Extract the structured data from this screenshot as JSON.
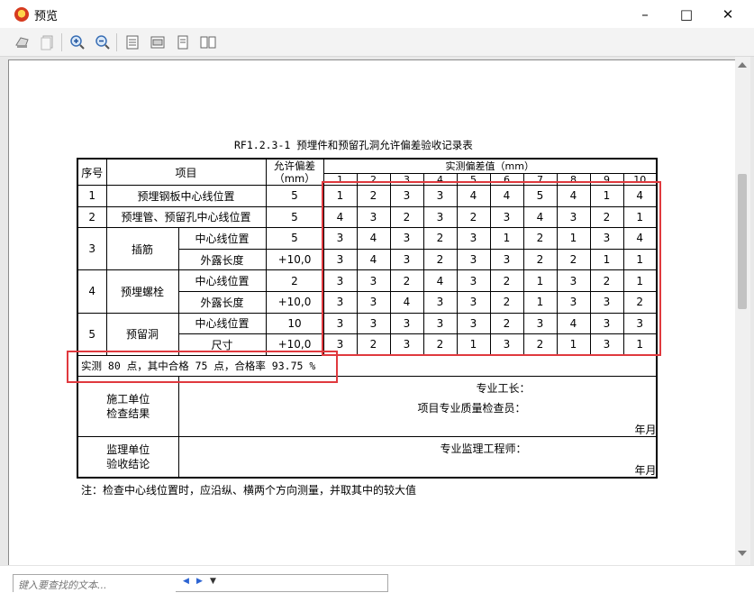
{
  "window": {
    "title": "预览"
  },
  "toolbar": {
    "buttons": [
      "print-icon",
      "copy-icon",
      "zoom-in-icon",
      "zoom-out-icon",
      "fit-page-icon",
      "fit-width-icon",
      "single-page-icon",
      "two-page-icon"
    ]
  },
  "document": {
    "title": "RF1.2.3-1 预埋件和预留孔洞允许偏差验收记录表",
    "headers": {
      "seq": "序号",
      "item": "项目",
      "tol1": "允许偏差",
      "tol2": "（mm）",
      "measured": "实测偏差值（mm）"
    },
    "cols": [
      "1",
      "2",
      "3",
      "4",
      "5",
      "6",
      "7",
      "8",
      "9",
      "10"
    ],
    "rows": [
      {
        "seq": "1",
        "item": "预埋钢板中心线位置",
        "sub": "",
        "tol": "5",
        "vals": [
          "1",
          "2",
          "3",
          "3",
          "4",
          "4",
          "5",
          "4",
          "1",
          "4"
        ]
      },
      {
        "seq": "2",
        "item": "预埋管、预留孔中心线位置",
        "sub": "",
        "tol": "5",
        "vals": [
          "4",
          "3",
          "2",
          "3",
          "2",
          "3",
          "4",
          "3",
          "2",
          "1"
        ]
      },
      {
        "seq": "3",
        "item": "插筋",
        "sub": "中心线位置",
        "tol": "5",
        "vals": [
          "3",
          "4",
          "3",
          "2",
          "3",
          "1",
          "2",
          "1",
          "3",
          "4"
        ]
      },
      {
        "seq": "",
        "item": "",
        "sub": "外露长度",
        "tol": "+10,0",
        "vals": [
          "3",
          "4",
          "3",
          "2",
          "3",
          "3",
          "2",
          "2",
          "1",
          "1"
        ]
      },
      {
        "seq": "4",
        "item": "预埋螺栓",
        "sub": "中心线位置",
        "tol": "2",
        "vals": [
          "3",
          "3",
          "2",
          "4",
          "3",
          "2",
          "1",
          "3",
          "2",
          "1"
        ]
      },
      {
        "seq": "",
        "item": "",
        "sub": "外露长度",
        "tol": "+10,0",
        "vals": [
          "3",
          "3",
          "4",
          "3",
          "3",
          "2",
          "1",
          "3",
          "3",
          "2"
        ]
      },
      {
        "seq": "5",
        "item": "预留洞",
        "sub": "中心线位置",
        "tol": "10",
        "vals": [
          "3",
          "3",
          "3",
          "3",
          "3",
          "2",
          "3",
          "4",
          "3",
          "3"
        ]
      },
      {
        "seq": "",
        "item": "",
        "sub": "尺寸",
        "tol": "+10,0",
        "vals": [
          "3",
          "2",
          "3",
          "2",
          "1",
          "3",
          "2",
          "1",
          "3",
          "1"
        ]
      }
    ],
    "summary": "实测 80 点，其中合格 75 点，合格率 93.75 %",
    "construction": {
      "label1": "施工单位",
      "label2": "检查结果",
      "foreman": "专业工长：",
      "inspector": "项目专业质量检查员：",
      "date": "年月日"
    },
    "supervision": {
      "label1": "监理单位",
      "label2": "验收结论",
      "engineer": "专业监理工程师：",
      "date": "年月日"
    },
    "note": "注：检查中心线位置时，应沿纵、横两个方向测量，并取其中的较大值"
  },
  "find": {
    "placeholder": "键入要查找的文本..."
  },
  "colors": {
    "highlight": "#e0393e",
    "toolbar": "#f3f3f3"
  }
}
